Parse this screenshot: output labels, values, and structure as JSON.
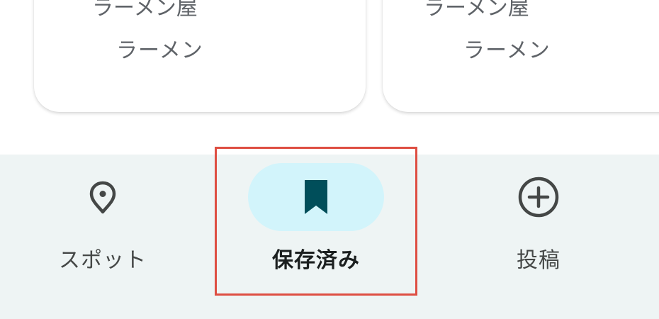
{
  "cards": [
    {
      "title": "ラーメン屋",
      "genre": "ラーメン"
    },
    {
      "title": "ラーメン屋",
      "genre": "ラーメン"
    }
  ],
  "bottom_nav": {
    "items": [
      {
        "label": "スポット",
        "icon": "location-pin-icon",
        "selected": false
      },
      {
        "label": "保存済み",
        "icon": "bookmark-icon",
        "selected": true
      },
      {
        "label": "投稿",
        "icon": "add-circle-icon",
        "selected": false
      }
    ]
  },
  "colors": {
    "nav_background": "#eef4f4",
    "selected_pill": "#d2f4fb",
    "selected_icon": "#004e5a",
    "icon_default": "#444746",
    "highlight_border": "#de4e42"
  }
}
